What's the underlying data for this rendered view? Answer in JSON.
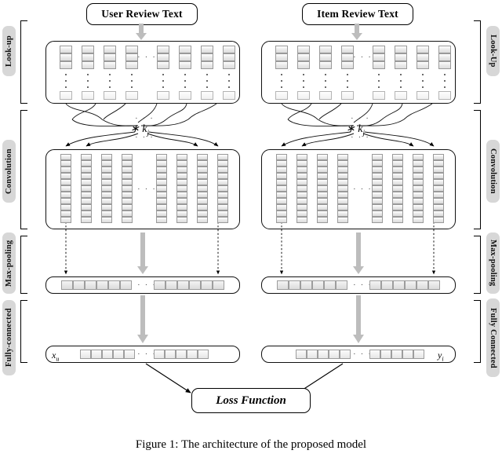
{
  "figure": {
    "caption": "Figure 1:  The architecture of the proposed model"
  },
  "branches": {
    "user": {
      "input_label": "User Review Text",
      "output_vector_label": "x",
      "output_vector_sub": "u",
      "kernel_label": "∗ k",
      "kernel_sub": "j",
      "ellipsis": "· · ·"
    },
    "item": {
      "input_label": "Item Review Text",
      "output_vector_label": "y",
      "output_vector_sub": "i",
      "kernel_label": "∗ k",
      "kernel_sub": "j",
      "ellipsis": "· · ·"
    }
  },
  "stages_left": [
    {
      "name": "lookup",
      "label": "Look-up"
    },
    {
      "name": "convolution",
      "label": "Convolution"
    },
    {
      "name": "max-pooling",
      "label": "Max-pooling"
    },
    {
      "name": "fully-connected",
      "label": "Fully-connected"
    }
  ],
  "stages_right": [
    {
      "name": "lookup",
      "label": "Look-Up"
    },
    {
      "name": "convolution",
      "label": "Convolution"
    },
    {
      "name": "max-pooling",
      "label": "Max-pooling"
    },
    {
      "name": "fully-connected",
      "label": "Fully Connected"
    }
  ],
  "output": {
    "loss_label": "Loss Function"
  },
  "layout": {
    "lookup_columns": 8,
    "lookup_cells_per_column": 3,
    "conv_columns": 8,
    "conv_cells_per_column": 11,
    "pool_cells_per_half": 6,
    "fc_cells_per_half": 5
  },
  "colors": {
    "cell_border": "#9a9a9a",
    "arrow_gray": "#bdbdbd",
    "stage_label_bg": "#d7d7d7",
    "stroke": "#000000"
  }
}
